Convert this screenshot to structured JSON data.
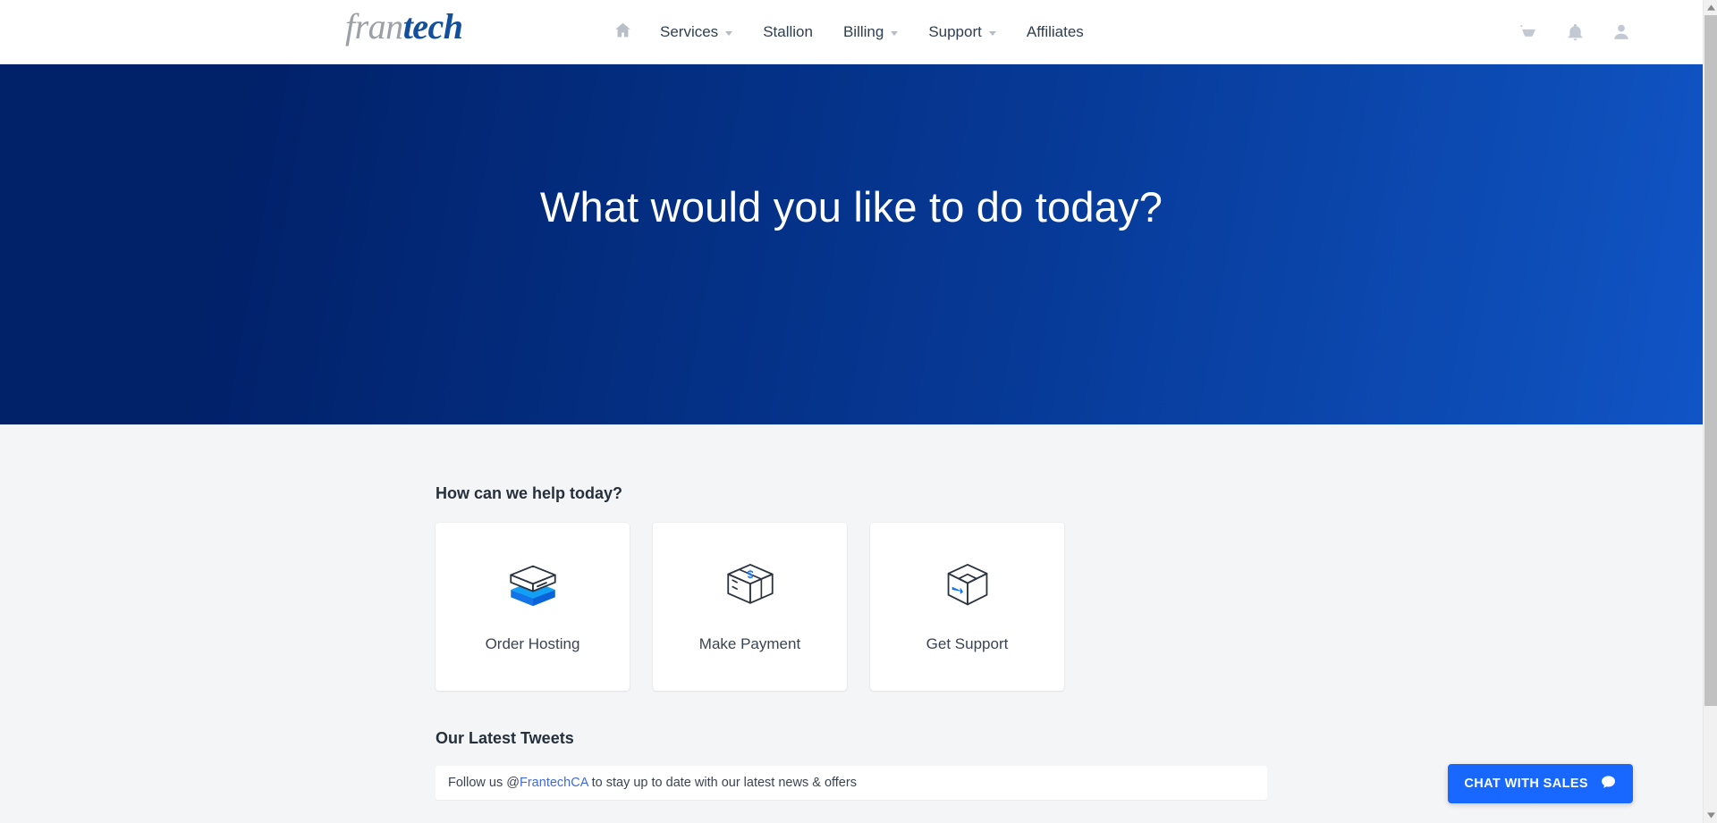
{
  "header": {
    "logo": {
      "part1": "fran",
      "part2": "tech"
    },
    "nav": [
      {
        "label": "",
        "icon": "home-icon",
        "name": "nav-home",
        "caret": false
      },
      {
        "label": "Services",
        "icon": "",
        "name": "nav-services",
        "caret": true
      },
      {
        "label": "Stallion",
        "icon": "",
        "name": "nav-stallion",
        "caret": false
      },
      {
        "label": "Billing",
        "icon": "",
        "name": "nav-billing",
        "caret": true
      },
      {
        "label": "Support",
        "icon": "",
        "name": "nav-support",
        "caret": true
      },
      {
        "label": "Affiliates",
        "icon": "",
        "name": "nav-affiliates",
        "caret": false
      }
    ],
    "right_icons": [
      {
        "name": "shopping-cart-icon"
      },
      {
        "name": "notification-bell-icon"
      },
      {
        "name": "user-account-icon"
      }
    ]
  },
  "hero": {
    "title": "What would you like to do today?",
    "gradient_start": "#012169",
    "gradient_end": "#1154c6"
  },
  "main": {
    "help_heading": "How can we help today?",
    "cards": [
      {
        "label": "Order Hosting",
        "icon": "server-stack-box-icon",
        "name": "card-order-hosting"
      },
      {
        "label": "Make Payment",
        "icon": "payment-box-dollar-icon",
        "name": "card-make-payment"
      },
      {
        "label": "Get Support",
        "icon": "open-box-arrow-icon",
        "name": "card-get-support"
      }
    ],
    "tweets_heading": "Our Latest Tweets",
    "tweet": {
      "prefix": "Follow us @",
      "handle": "FrantechCA",
      "suffix": " to stay up to date with our latest news & offers"
    }
  },
  "chat": {
    "label": "CHAT WITH SALES",
    "icon": "speech-bubble-icon",
    "color": "#1867ff"
  },
  "scrollbar": {
    "up_arrow": "scroll-up-arrow-icon",
    "down_arrow": "scroll-down-arrow-icon"
  }
}
